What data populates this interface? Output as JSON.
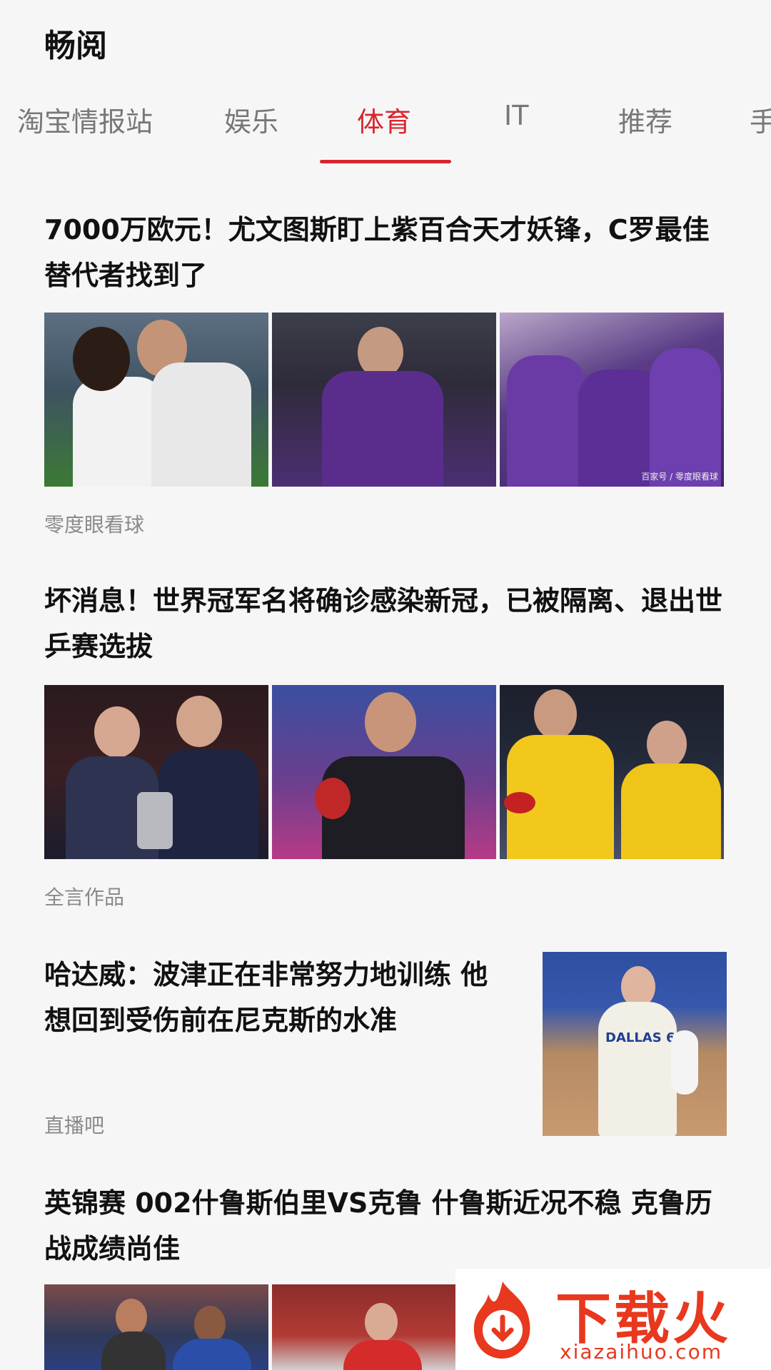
{
  "app": {
    "title": "畅阅"
  },
  "tabs": [
    {
      "label": "淘宝情报站",
      "active": false
    },
    {
      "label": "娱乐",
      "active": false
    },
    {
      "label": "体育",
      "active": true
    },
    {
      "label": "IT",
      "active": false
    },
    {
      "label": "推荐",
      "active": false
    },
    {
      "label": "手",
      "active": false
    }
  ],
  "colors": {
    "accent": "#d7262f",
    "background": "#f6f6f7",
    "source_text": "#8a8a8a"
  },
  "articles": [
    {
      "headline": "7000万欧元！尤文图斯盯上紫百合天才妖锋，C罗最佳替代者找到了",
      "source": "零度眼看球",
      "image_layout": "three-images",
      "images": [
        "football-players-hugging",
        "fiorentina-player",
        "fiorentina-team-celebrating"
      ],
      "image_caption": "百家号 / 零度眼看球"
    },
    {
      "headline": "坏消息！世界冠军名将确诊感染新冠，已被隔离、退出世乒赛选拔",
      "source": "全言作品",
      "image_layout": "three-images",
      "images": [
        "table-tennis-pair-with-trophy",
        "table-tennis-player-celebrating",
        "table-tennis-doubles-pair"
      ]
    },
    {
      "headline": "哈达威：波津正在非常努力地训练 他想回到受伤前在尼克斯的水准",
      "source": "直播吧",
      "image_layout": "single-right",
      "images": [
        "dallas-basketball-player"
      ],
      "jersey_text": "DALLAS 6"
    },
    {
      "headline": "英锦赛 002什鲁斯伯里VS克鲁 什鲁斯近况不稳 克鲁历战成绩尚佳",
      "image_layout": "three-images",
      "images": [
        "soccer-match-players",
        "soccer-player-red-kit"
      ]
    }
  ],
  "watermark": {
    "brand": "下载火",
    "url": "xiazaihuo.com",
    "icon": "fire-download-icon"
  }
}
